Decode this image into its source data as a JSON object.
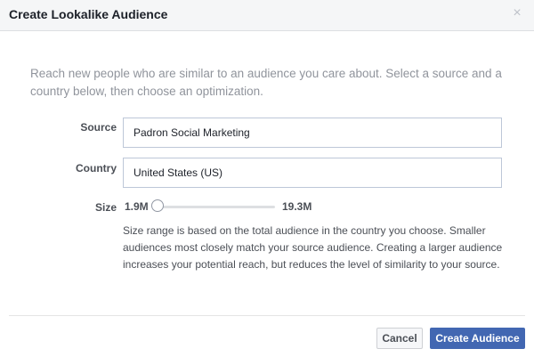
{
  "dialog": {
    "title": "Create Lookalike Audience",
    "close_icon": "close-icon",
    "close_glyph": "×",
    "intro": "Reach new people who are similar to an audience you care about. Select a source and a country below, then choose an optimization."
  },
  "form": {
    "source_label": "Source",
    "source_value": "Padron Social Marketing",
    "country_label": "Country",
    "country_value": "United States (US)",
    "size_label": "Size",
    "size_min": "1.9M",
    "size_max": "19.3M",
    "size_slider_level": 0,
    "help_text": "Size range is based on the total audience in the country you choose. Smaller audiences most closely match your source audience. Creating a larger audience increases your potential reach, but reduces the level of similarity to your source."
  },
  "footer": {
    "cancel_label": "Cancel",
    "create_label": "Create Audience"
  },
  "colors": {
    "primary_button": "#4267b2",
    "header_bg": "#f5f6f7",
    "muted_text": "#90949c"
  }
}
